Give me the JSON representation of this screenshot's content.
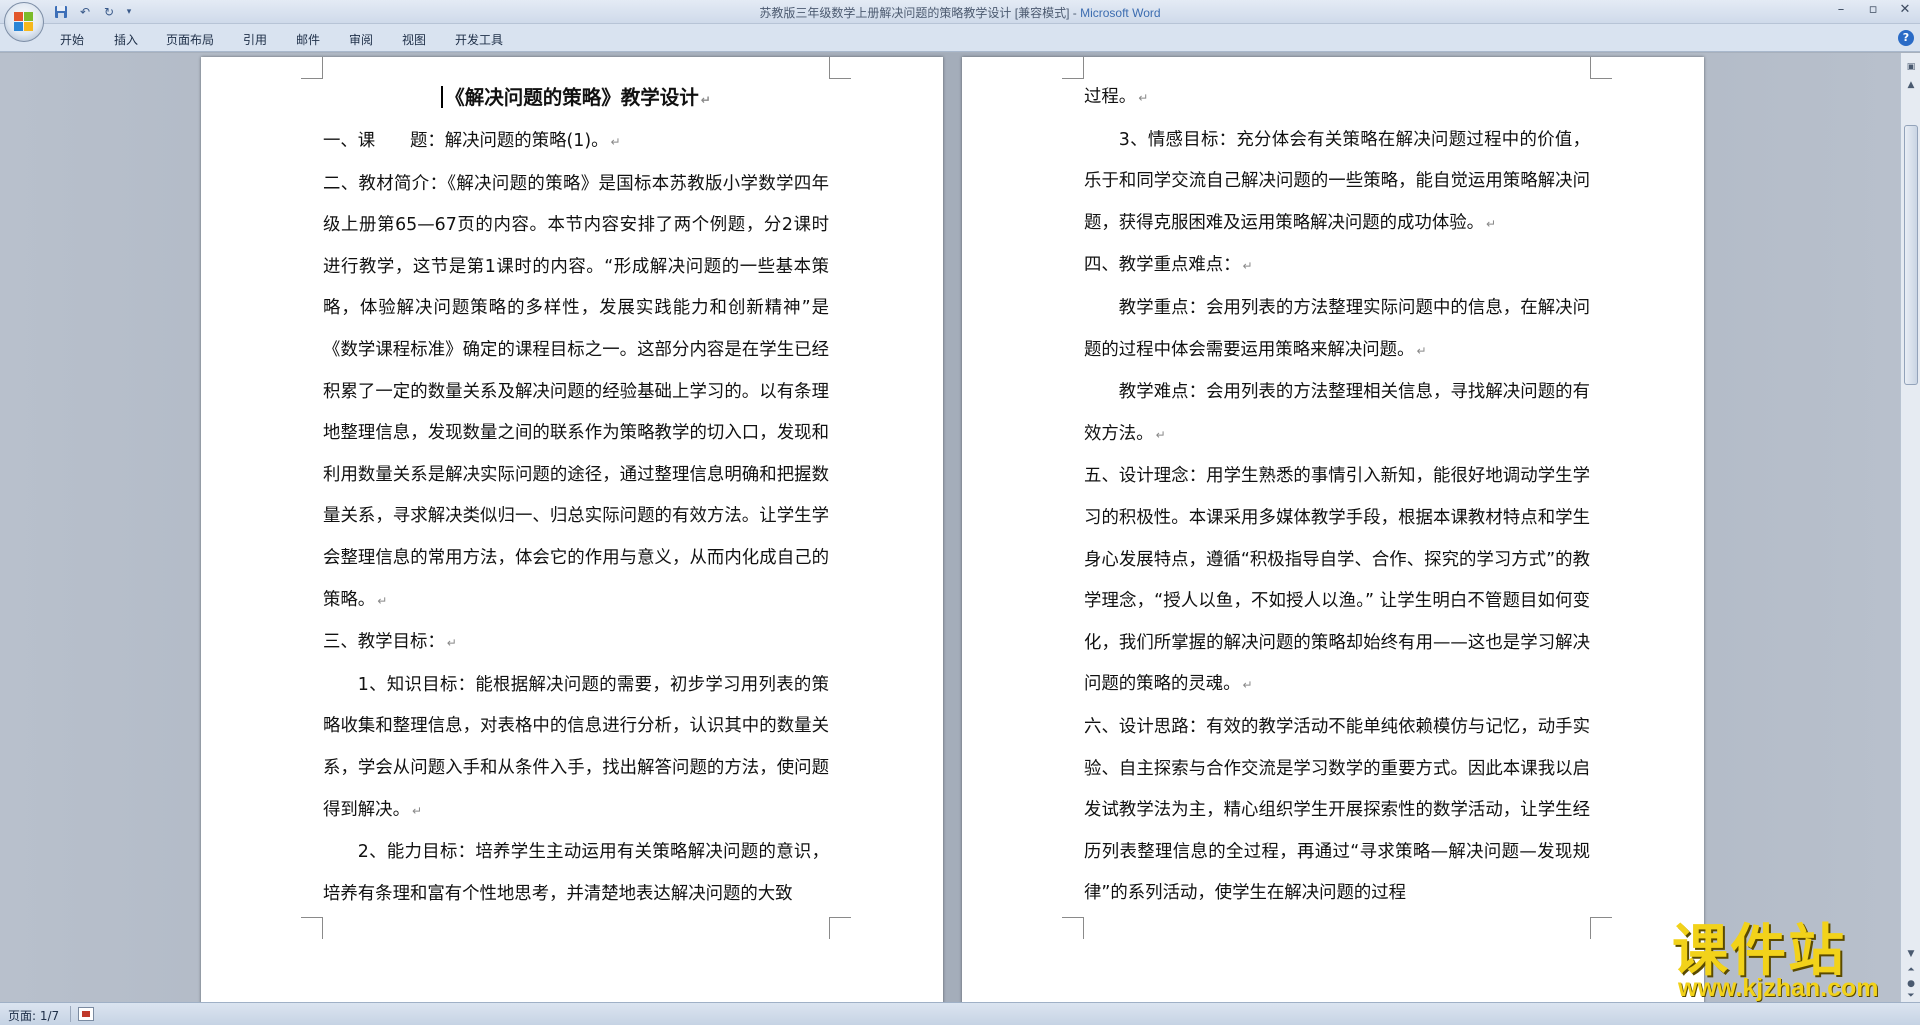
{
  "window": {
    "title_doc": "苏教版三年级数学上册解决问题的策略教学设计 [兼容模式] - ",
    "title_app": "Microsoft Word"
  },
  "ribbon": {
    "tabs": [
      "开始",
      "插入",
      "页面布局",
      "引用",
      "邮件",
      "审阅",
      "视图",
      "开发工具"
    ]
  },
  "left_page": {
    "title": "《解决问题的策略》教学设计",
    "paragraphs": [
      {
        "text": "一、课　　题：解决问题的策略(1)。",
        "indent": false
      },
      {
        "text": "二、教材简介：《解决问题的策略》是国标本苏教版小学数学四年级上册第65—67页的内容。本节内容安排了两个例题，分2课时进行教学，这节是第1课时的内容。“形成解决问题的一些基本策略，体验解决问题策略的多样性，发展实践能力和创新精神”是《数学课程标准》确定的课程目标之一。这部分内容是在学生已经积累了一定的数量关系及解决问题的经验基础上学习的。以有条理地整理信息，发现数量之间的联系作为策略教学的切入口，发现和利用数量关系是解决实际问题的途径，通过整理信息明确和把握数量关系，寻求解决类似归一、归总实际问题的有效方法。让学生学会整理信息的常用方法，体会它的作用与意义，从而内化成自己的策略。",
        "indent": false
      },
      {
        "text": "三、教学目标：",
        "indent": false
      },
      {
        "text": "1、知识目标：能根据解决问题的需要，初步学习用列表的策略收集和整理信息，对表格中的信息进行分析，认识其中的数量关系，学会从问题入手和从条件入手，找出解答问题的方法，使问题得到解决。",
        "indent": true
      },
      {
        "text": "2、能力目标：培养学生主动运用有关策略解决问题的意识，培养有条理和富有个性地思考，并清楚地表达解决问题的大致",
        "indent": true,
        "no_mark": true
      }
    ]
  },
  "right_page": {
    "paragraphs": [
      {
        "text": "过程。",
        "indent": false
      },
      {
        "text": "3、情感目标：充分体会有关策略在解决问题过程中的价值，乐于和同学交流自己解决问题的一些策略，能自觉运用策略解决问题，获得克服困难及运用策略解决问题的成功体验。",
        "indent": true
      },
      {
        "text": "四、教学重点难点：",
        "indent": false
      },
      {
        "text": "教学重点：会用列表的方法整理实际问题中的信息，在解决问题的过程中体会需要运用策略来解决问题。",
        "indent": true
      },
      {
        "text": "教学难点：会用列表的方法整理相关信息，寻找解决问题的有效方法。",
        "indent": true
      },
      {
        "text": "五、设计理念：用学生熟悉的事情引入新知，能很好地调动学生学习的积极性。本课采用多媒体教学手段，根据本课教材特点和学生身心发展特点，遵循“积极指导自学、合作、探究的学习方式”的教学理念，“授人以鱼，不如授人以渔。” 让学生明白不管题目如何变化，我们所掌握的解决问题的策略却始终有用——这也是学习解决问题的策略的灵魂。",
        "indent": false
      },
      {
        "text": "六、设计思路：有效的教学活动不能单纯依赖模仿与记忆，动手实验、自主探索与合作交流是学习数学的重要方式。因此本课我以启发试教学法为主，精心组织学生开展探索性的数学活动，让学生经历列表整理信息的全过程，再通过“寻求策略—解决问题—发现规律”的系列活动，使学生在解决问题的过程",
        "indent": false,
        "no_mark": true
      }
    ]
  },
  "paragraph_mark": "↵",
  "status": {
    "page_indicator": "页面: 1/7"
  },
  "watermark": {
    "text": "课件站",
    "url": "www.kjzhan.com"
  }
}
